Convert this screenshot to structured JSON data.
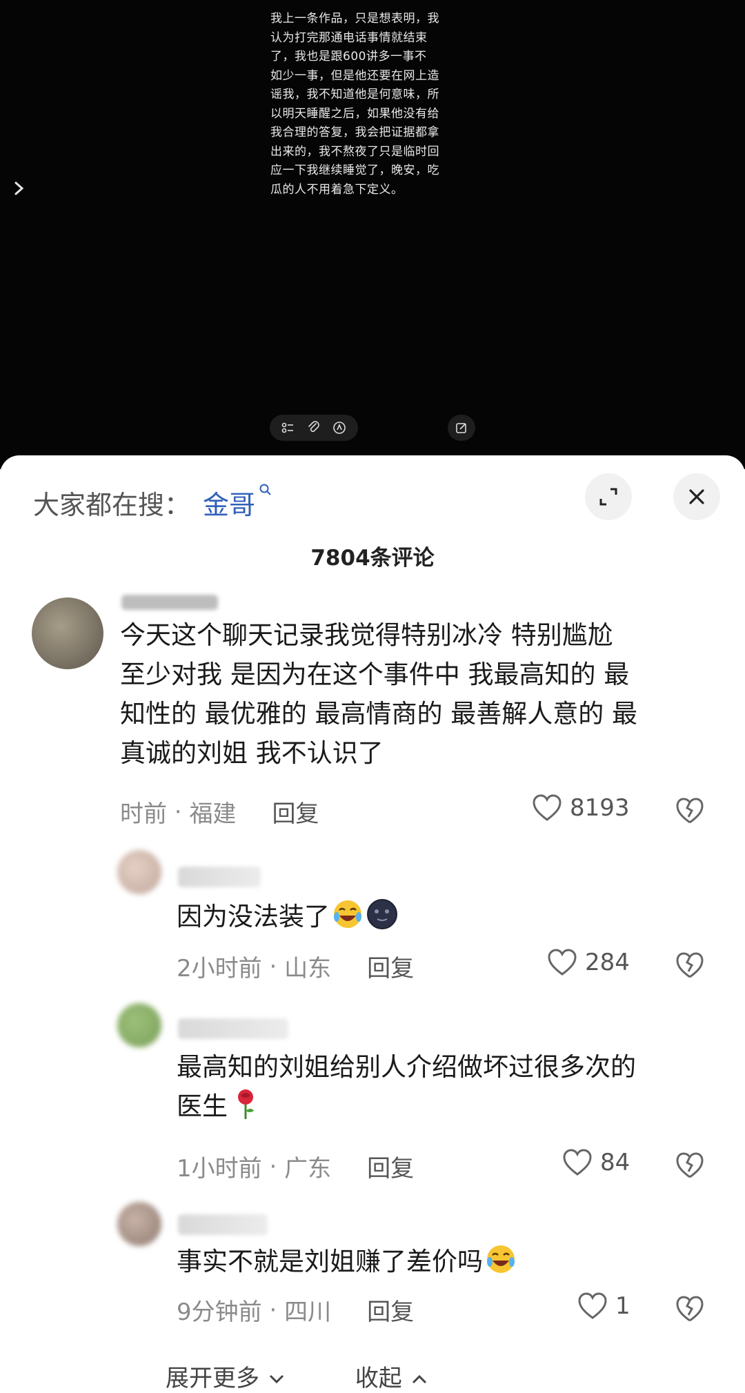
{
  "note": {
    "text": "我上一条作品，只是想表明，我\n认为打完那通电话事情就结束\n了，我也是跟600讲多一事不\n如少一事，但是他还要在网上造\n谣我，我不知道他是何意味，所\n以明天睡醒之后，如果他没有给\n我合理的答复，我会把证据都拿\n出来的，我不熬夜了只是临时回\n应一下我继续睡觉了，晚安，吃\n瓜的人不用着急下定义。",
    "toolbar_icons": [
      "checklist-icon",
      "paperclip-icon",
      "pen-circle-icon",
      "edit-icon"
    ]
  },
  "search": {
    "prefix": "大家都在搜：",
    "term": "金哥"
  },
  "comments_header": "7804条评论",
  "comments": [
    {
      "username": "我不想想",
      "text": "今天这个聊天记录我觉得特别冰冷 特别尴尬\n至少对我 是因为在这个事件中 我最高知的 最\n知性的 最优雅的 最高情商的 最善解人意的 最\n真诚的刘姐 我不认识了",
      "time": "时前",
      "location": "福建",
      "reply": "回复",
      "likes": "8193"
    },
    {
      "text": "因为没法装了",
      "emojis": [
        "laughing-crying-emoji",
        "dark-moon-emoji"
      ],
      "time": "2小时前",
      "location": "山东",
      "reply": "回复",
      "likes": "284"
    },
    {
      "text": "最高知的刘姐给别人介绍做坏过很多次的\n医生",
      "emojis": [
        "rose-emoji"
      ],
      "time": "1小时前",
      "location": "广东",
      "reply": "回复",
      "likes": "84"
    },
    {
      "text": "事实不就是刘姐赚了差价吗",
      "emojis": [
        "laughing-crying-emoji"
      ],
      "time": "9分钟前",
      "location": "四川",
      "reply": "回复",
      "likes": "1"
    }
  ],
  "footer": {
    "expand": "展开更多",
    "collapse": "收起"
  },
  "colors": {
    "link_blue": "#2f5fb8",
    "background_dark": "#050505"
  }
}
